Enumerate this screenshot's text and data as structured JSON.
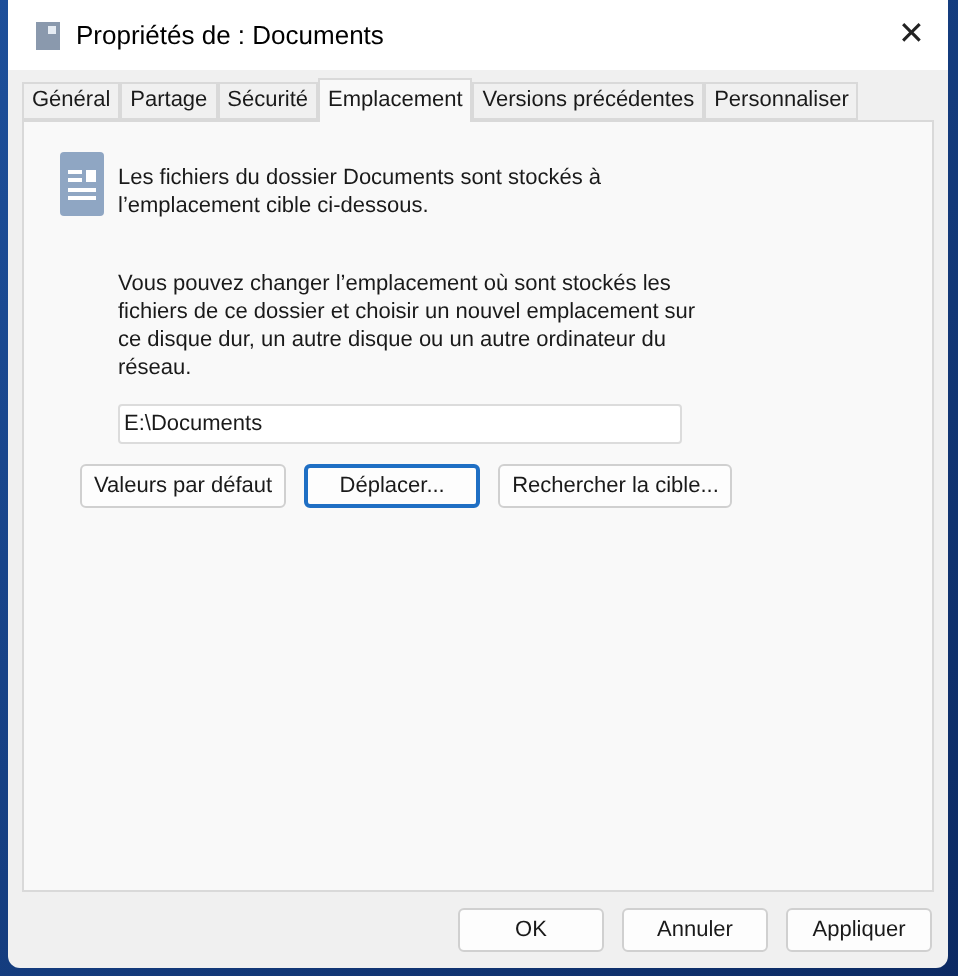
{
  "window": {
    "title": "Propriétés de : Documents",
    "close": "✕"
  },
  "tabs": [
    {
      "label": "Général",
      "selected": false
    },
    {
      "label": "Partage",
      "selected": false
    },
    {
      "label": "Sécurité",
      "selected": false
    },
    {
      "label": "Emplacement",
      "selected": true
    },
    {
      "label": "Versions précédentes",
      "selected": false
    },
    {
      "label": "Personnaliser",
      "selected": false
    }
  ],
  "intro": "Les fichiers du dossier Documents sont stockés à l’emplacement cible ci-dessous.",
  "description": "Vous pouvez changer l’emplacement où sont stockés les fichiers de ce dossier et choisir un nouvel emplacement sur ce disque dur, un autre disque ou un autre ordinateur du réseau.",
  "path_field": {
    "value": "E:\\Documents"
  },
  "location_buttons": [
    {
      "label": "Valeurs par défaut",
      "focused": false
    },
    {
      "label": "Déplacer...",
      "focused": true
    },
    {
      "label": "Rechercher la cible...",
      "focused": false
    }
  ],
  "dialog_buttons": [
    {
      "label": "OK"
    },
    {
      "label": "Annuler"
    },
    {
      "label": "Appliquer"
    }
  ]
}
